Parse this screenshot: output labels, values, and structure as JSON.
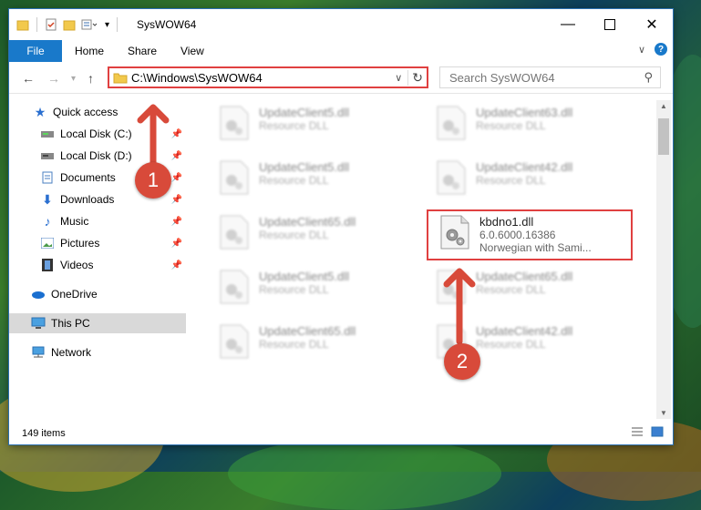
{
  "window": {
    "title": "SysWOW64"
  },
  "ribbon": {
    "tabs": [
      "File",
      "Home",
      "Share",
      "View"
    ]
  },
  "address": {
    "path": "C:\\Windows\\SysWOW64",
    "search_placeholder": "Search SysWOW64"
  },
  "sidebar": {
    "items": [
      {
        "label": "Quick access",
        "icon": "star-icon"
      },
      {
        "label": "Local Disk (C:)",
        "icon": "drive-icon"
      },
      {
        "label": "Local Disk (D:)",
        "icon": "drive-icon"
      },
      {
        "label": "Documents",
        "icon": "documents-icon"
      },
      {
        "label": "Downloads",
        "icon": "download-icon"
      },
      {
        "label": "Music",
        "icon": "music-icon"
      },
      {
        "label": "Pictures",
        "icon": "pictures-icon"
      },
      {
        "label": "Videos",
        "icon": "videos-icon"
      },
      {
        "label": "OneDrive",
        "icon": "cloud-icon"
      },
      {
        "label": "This PC",
        "icon": "computer-icon"
      },
      {
        "label": "Network",
        "icon": "network-icon"
      }
    ]
  },
  "files": [
    {
      "name": "UpdateClient5.dll",
      "desc": "Resource DLL"
    },
    {
      "name": "UpdateClient63.dll",
      "desc": "Resource DLL"
    },
    {
      "name": "UpdateClient5.dll",
      "desc": "Resource DLL"
    },
    {
      "name": "UpdateClient42.dll",
      "desc": "Resource DLL"
    },
    {
      "name": "UpdateClient65.dll",
      "desc": "Resource DLL"
    },
    {
      "name": "kbdno1.dll",
      "version": "6.0.6000.16386",
      "desc": "Norwegian with Sami..."
    },
    {
      "name": "UpdateClient5.dll",
      "desc": "Resource DLL"
    },
    {
      "name": "UpdateClient65.dll",
      "desc": "Resource DLL"
    },
    {
      "name": "UpdateClient65.dll",
      "desc": "Resource DLL"
    },
    {
      "name": "UpdateClient42.dll",
      "desc": "Resource DLL"
    }
  ],
  "status": {
    "count": "149 items"
  },
  "annotations": {
    "step1": "1",
    "step2": "2"
  },
  "colors": {
    "accent": "#1979ca",
    "highlight": "#e04040",
    "badge": "#d84a3a"
  }
}
